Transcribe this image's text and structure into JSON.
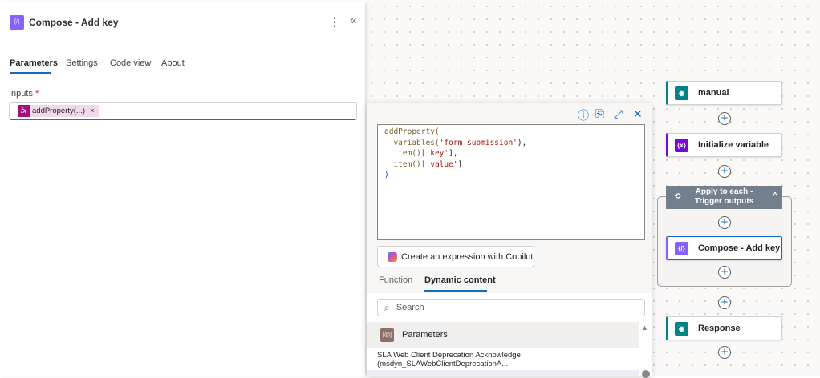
{
  "panel": {
    "title": "Compose - Add key",
    "tabs": [
      "Parameters",
      "Settings",
      "Code view",
      "About"
    ],
    "inputs_label": "Inputs",
    "required_mark": "*",
    "token": "addProperty(...)",
    "token_remove": "×",
    "more": "⋮",
    "collapse": "«"
  },
  "popup": {
    "code": {
      "l1": "addProperty(",
      "l2a": "variables(",
      "l2b": "'form_submission'",
      "l2c": "),",
      "l3a": "item()[",
      "l3b": "'key'",
      "l3c": "],",
      "l4a": "item()[",
      "l4b": "'value'",
      "l4c": "]",
      "l5": ")"
    },
    "copilot_button": "Create an expression with Copilot",
    "tabs": [
      "Function",
      "Dynamic content"
    ],
    "search_placeholder": "Search",
    "section": "Parameters",
    "item": "SLA Web Client Deprecation Acknowledge (msdyn_SLAWebClientDeprecationA..."
  },
  "flow": {
    "nodes": [
      "manual",
      "Initialize variable",
      "Apply to each - Trigger outputs",
      "Compose - Add key",
      "Response"
    ]
  },
  "colors": {
    "accent": "#0f6cbd",
    "compose": "#8661ff",
    "variable": "#770bd6",
    "trigger": "#038387",
    "loop": "#737f8c"
  }
}
